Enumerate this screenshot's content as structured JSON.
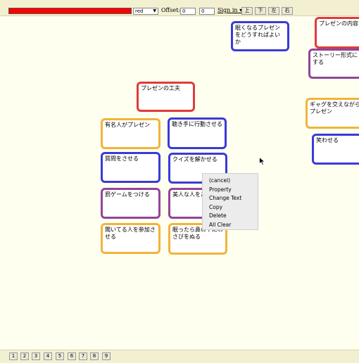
{
  "toolbar": {
    "color_value": "red",
    "color_swatch": "#ff0000",
    "offset_label": "Offset:",
    "offset_x": "0",
    "offset_y": "0",
    "signin_label": "Sign in ▾",
    "nav_buttons": [
      "上",
      "下",
      "左",
      "右"
    ]
  },
  "cards": [
    {
      "text": "眠くなるプレゼンをどうすればよいか",
      "color": "#3a3ad8"
    },
    {
      "text": "プレゼンの内容",
      "color": "#e03a3a"
    },
    {
      "text": "ストーリー形式にする",
      "color": "#93449a"
    },
    {
      "text": "プレゼンの工夫",
      "color": "#e03a3a"
    },
    {
      "text": "ギャグを交えながらプレゼン",
      "color": "#f0b43a"
    },
    {
      "text": "有名人がプレゼン",
      "color": "#f0b43a"
    },
    {
      "text": "聴き手に行動させる",
      "color": "#3a3ad8"
    },
    {
      "text": "笑わせる",
      "color": "#3a3ad8"
    },
    {
      "text": "質問をさせる",
      "color": "#3a3ad8"
    },
    {
      "text": "クイズを解かせる",
      "color": "#3a3ad8"
    },
    {
      "text": "罰ゲームをつける",
      "color": "#93449a"
    },
    {
      "text": "美人な人をあてる",
      "color": "#93449a"
    },
    {
      "text": "聞いてる人を参加させる",
      "color": "#f0b43a"
    },
    {
      "text": "眠ったら鼻の下にわさびをぬる",
      "color": "#f0b43a"
    }
  ],
  "context_menu": [
    "(cancel)",
    "Property",
    "Change Text",
    "Copy",
    "Delete",
    "All Clear"
  ],
  "page_buttons": [
    "1",
    "2",
    "3",
    "4",
    "5",
    "6",
    "7",
    "8",
    "9"
  ]
}
